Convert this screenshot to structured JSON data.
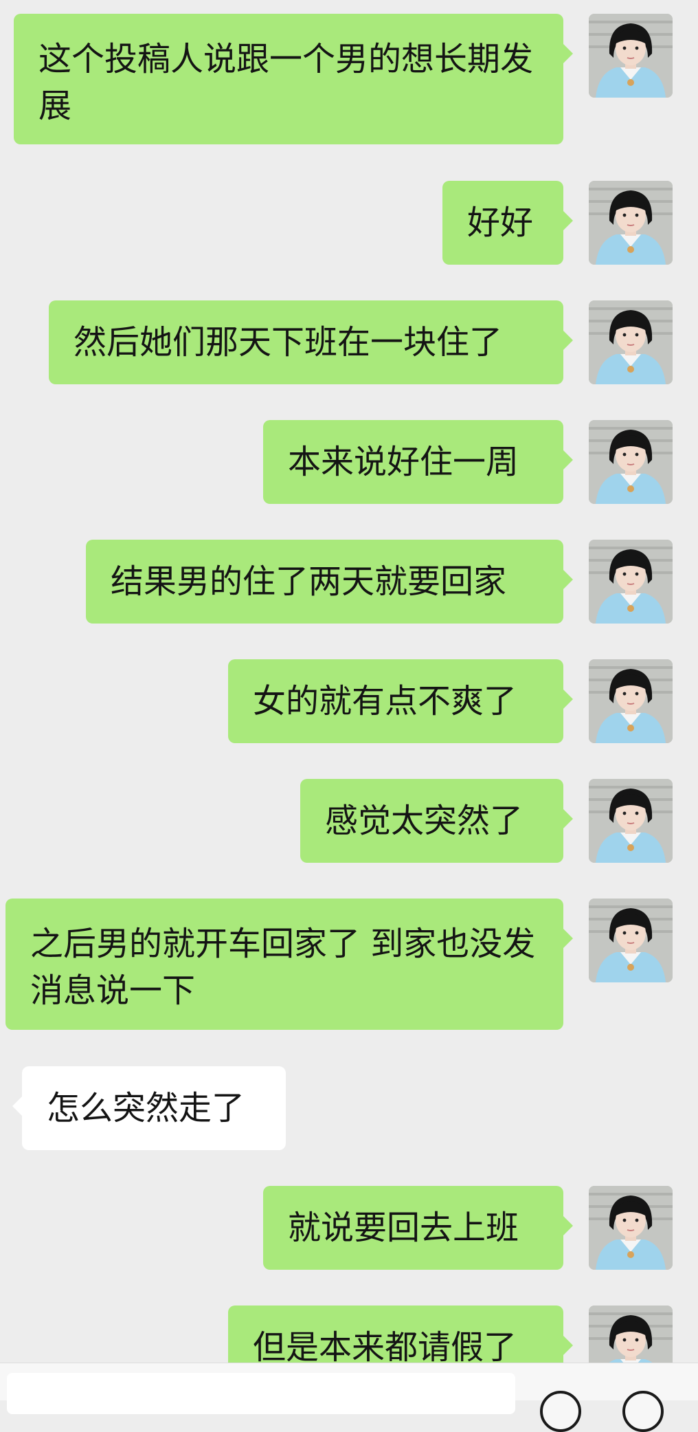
{
  "messages": [
    {
      "side": "me",
      "text": "这个投稿人说跟一个男的想长期发展"
    },
    {
      "side": "me",
      "text": "好好"
    },
    {
      "side": "me",
      "text": "然后她们那天下班在一块住了"
    },
    {
      "side": "me",
      "text": "本来说好住一周"
    },
    {
      "side": "me",
      "text": "结果男的住了两天就要回家"
    },
    {
      "side": "me",
      "text": "女的就有点不爽了"
    },
    {
      "side": "me",
      "text": "感觉太突然了"
    },
    {
      "side": "me",
      "text": "之后男的就开车回家了 到家也没发消息说一下"
    },
    {
      "side": "other",
      "text": "怎么突然走了"
    },
    {
      "side": "me",
      "text": "就说要回去上班"
    },
    {
      "side": "me",
      "text": "但是本来都请假了"
    }
  ],
  "colors": {
    "me_bubble": "#a9e97b",
    "other_bubble": "#ffffff",
    "background": "#ededed"
  },
  "icons": {
    "voice": "voice-icon",
    "emoji": "emoji-icon"
  }
}
